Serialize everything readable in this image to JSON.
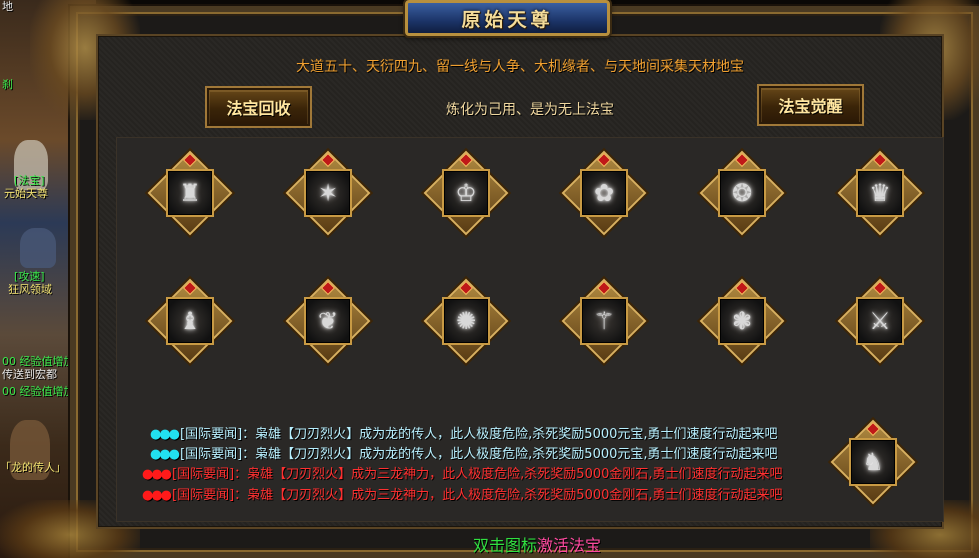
{
  "left_strip": {
    "top_text": "地",
    "item1": "刹",
    "tag1": "[法宝]",
    "tag1_name": "元始天尊",
    "tag2": "[攻速]",
    "tag2_name": "狂风领域",
    "exp1": "00 经验值增加:",
    "teleport": "传送到宏都",
    "exp2": "00 经验值增加:",
    "dragon_tag": "「龙的传人」"
  },
  "title": "原始天尊",
  "subtitle_line1": "大道五十、天衍四九、留一线与人争、大机缘者、与天地间采集天材地宝",
  "subtitle_line2": "炼化为己用、是为无上法宝",
  "buttons": {
    "recycle": "法宝回收",
    "awaken": "法宝觉醒"
  },
  "treasures": [
    {
      "icon": "ornate-idol-icon",
      "glyph": "♜"
    },
    {
      "icon": "winged-spirit-icon",
      "glyph": "✶"
    },
    {
      "icon": "cauldron-icon",
      "glyph": "♔"
    },
    {
      "icon": "lotus-icon",
      "glyph": "✿"
    },
    {
      "icon": "lion-head-icon",
      "glyph": "❂"
    },
    {
      "icon": "armor-idol-icon",
      "glyph": "♛"
    },
    {
      "icon": "pagoda-icon",
      "glyph": "♝"
    },
    {
      "icon": "spirit-beast-icon",
      "glyph": "❦"
    },
    {
      "icon": "jade-disc-icon",
      "glyph": "✺"
    },
    {
      "icon": "staff-bell-icon",
      "glyph": "⚚"
    },
    {
      "icon": "dragon-coil-icon",
      "glyph": "❃"
    },
    {
      "icon": "crossed-swords-icon",
      "glyph": "⚔"
    },
    {
      "icon": "guardian-beast-icon",
      "glyph": "♞"
    }
  ],
  "news": [
    {
      "dots": "●●●",
      "text": "[国际要闻]：枭雄【刀刃烈火】成为龙的传人，此人极度危险,杀死奖励5000元宝,勇士们速度行动起来吧",
      "color": "cyan"
    },
    {
      "dots": "●●●",
      "text": "[国际要闻]：枭雄【刀刃烈火】成为龙的传人，此人极度危险,杀死奖励5000元宝,勇士们速度行动起来吧",
      "color": "cyan"
    },
    {
      "dots": "●●●",
      "text": "[国际要闻]：枭雄【刀刃烈火】成为三龙神力，此人极度危险,杀死奖励5000金刚石,勇士们速度行动起来吧",
      "color": "red"
    },
    {
      "dots": "●●●",
      "text": "[国际要闻]：枭雄【刀刃烈火】成为三龙神力，此人极度危险,杀死奖励5000金刚石,勇士们速度行动起来吧",
      "color": "red"
    }
  ],
  "hint": {
    "part1": "双击图标",
    "part2": "激活法宝"
  },
  "colors": {
    "title_text": "#f4dc9a",
    "subtitle": "#f0a030",
    "news_cyan": "#22e0f0",
    "news_red": "#ff1a1a",
    "hint_green": "#30e040",
    "hint_pink": "#ff4aa0"
  }
}
